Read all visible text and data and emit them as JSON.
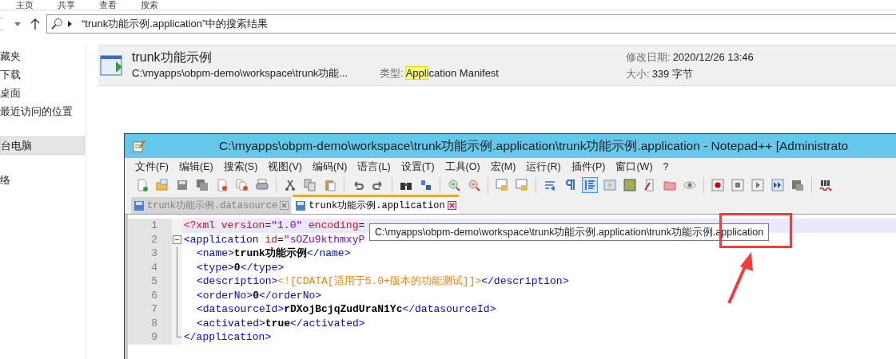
{
  "ribbon_tabs": [
    {
      "label": "主页"
    },
    {
      "label": "共享"
    },
    {
      "label": "查看"
    },
    {
      "label": "搜索"
    }
  ],
  "address_bar": {
    "text": "“trunk功能示例.application”中的搜索结果"
  },
  "sidebar": {
    "groups": [
      {
        "items": [
          {
            "label": "藏夹",
            "selected": false
          },
          {
            "label": "下载",
            "selected": false
          },
          {
            "label": "桌面",
            "selected": false
          },
          {
            "label": "最近访问的位置",
            "selected": false
          }
        ]
      },
      {
        "items": [
          {
            "label": "台电脑",
            "selected": true
          }
        ]
      },
      {
        "items": [
          {
            "label": "络",
            "selected": false
          }
        ]
      }
    ]
  },
  "result": {
    "name": "trunk功能示例",
    "path": "C:\\myapps\\obpm-demo\\workspace\\trunk功能...",
    "type_label": "类型:",
    "type_match": "Appl",
    "type_rest": "ication Manifest",
    "date_label": "修改日期:",
    "date_value": "2020/12/26 13:46",
    "size_label": "大小:",
    "size_value": "339 字节"
  },
  "notepad": {
    "title": "C:\\myapps\\obpm-demo\\workspace\\trunk功能示例.application\\trunk功能示例.application - Notepad++ [Administrato",
    "menu": [
      "文件(F)",
      "编辑(E)",
      "搜索(S)",
      "视图(V)",
      "编码(N)",
      "语言(L)",
      "设置(T)",
      "工具(O)",
      "宏(M)",
      "运行(R)",
      "插件(P)",
      "窗口(W)",
      "?"
    ],
    "toolbar": [
      {
        "kind": "new",
        "selected": false
      },
      {
        "kind": "open",
        "selected": false
      },
      {
        "kind": "save",
        "selected": false
      },
      {
        "kind": "saveall",
        "selected": false
      },
      {
        "kind": "close",
        "selected": false
      },
      {
        "kind": "closeall",
        "selected": false
      },
      {
        "kind": "print",
        "selected": false
      },
      {
        "kind": "sep"
      },
      {
        "kind": "cut",
        "selected": false
      },
      {
        "kind": "copy",
        "selected": false
      },
      {
        "kind": "paste",
        "selected": false
      },
      {
        "kind": "sep"
      },
      {
        "kind": "undo",
        "selected": false
      },
      {
        "kind": "redo",
        "selected": false
      },
      {
        "kind": "sep"
      },
      {
        "kind": "find",
        "selected": false
      },
      {
        "kind": "replace",
        "selected": false
      },
      {
        "kind": "sep"
      },
      {
        "kind": "zoomin",
        "selected": false
      },
      {
        "kind": "zoomout",
        "selected": false
      },
      {
        "kind": "sep"
      },
      {
        "kind": "syncv",
        "selected": false
      },
      {
        "kind": "synch",
        "selected": false
      },
      {
        "kind": "sep"
      },
      {
        "kind": "wrap",
        "selected": false
      },
      {
        "kind": "para",
        "selected": false
      },
      {
        "kind": "indent",
        "selected": true
      },
      {
        "kind": "lang",
        "selected": false
      },
      {
        "kind": "map",
        "selected": false
      },
      {
        "kind": "func",
        "selected": false
      },
      {
        "kind": "folder",
        "selected": false
      },
      {
        "kind": "eye",
        "selected": false
      },
      {
        "kind": "sep"
      },
      {
        "kind": "record",
        "selected": false
      },
      {
        "kind": "stop",
        "selected": false
      },
      {
        "kind": "play",
        "selected": false
      },
      {
        "kind": "playmulti",
        "selected": false
      },
      {
        "kind": "savemacro",
        "selected": false
      },
      {
        "kind": "sep"
      },
      {
        "kind": "spell",
        "selected": false
      }
    ],
    "tabs": [
      {
        "label": "trunk功能示例.datasource",
        "selected": false
      },
      {
        "label": "trunk功能示例.application",
        "selected": true
      }
    ],
    "lines": [
      {
        "number": "1",
        "kind": "plain",
        "current": true,
        "segments": [
          {
            "kind": "pi",
            "text": "<?xml"
          },
          {
            "kind": "attr",
            "text": " version"
          },
          {
            "kind": "eq",
            "text": "="
          },
          {
            "kind": "value",
            "text": "\"1.0\""
          },
          {
            "kind": "attr",
            "text": " encoding"
          },
          {
            "kind": "eq",
            "text": "="
          }
        ]
      },
      {
        "number": "2",
        "kind": "fold-start",
        "current": false,
        "segments": [
          {
            "kind": "tag",
            "text": "<application"
          },
          {
            "kind": "attr",
            "text": " id"
          },
          {
            "kind": "eq",
            "text": "="
          },
          {
            "kind": "value",
            "text": "\"sOZu9kthmxyP"
          }
        ]
      },
      {
        "number": "3",
        "kind": "fold-body",
        "current": false,
        "segments": [
          {
            "kind": "tag",
            "text": "<name>"
          },
          {
            "kind": "text",
            "text": "trunk功能示例"
          },
          {
            "kind": "tag",
            "text": "</name>"
          }
        ]
      },
      {
        "number": "4",
        "kind": "fold-body",
        "current": false,
        "segments": [
          {
            "kind": "tag",
            "text": "<type>"
          },
          {
            "kind": "text",
            "text": "0"
          },
          {
            "kind": "tag",
            "text": "</type>"
          }
        ]
      },
      {
        "number": "5",
        "kind": "fold-body",
        "current": false,
        "segments": [
          {
            "kind": "tag",
            "text": "<description>"
          },
          {
            "kind": "cdata",
            "text": "<![CDATA[适用于5.0+版本的功能测试]]>"
          },
          {
            "kind": "tag",
            "text": "</description>"
          }
        ]
      },
      {
        "number": "6",
        "kind": "fold-body",
        "current": false,
        "segments": [
          {
            "kind": "tag",
            "text": "<orderNo>"
          },
          {
            "kind": "text",
            "text": "0"
          },
          {
            "kind": "tag",
            "text": "</orderNo>"
          }
        ]
      },
      {
        "number": "7",
        "kind": "fold-body",
        "current": false,
        "segments": [
          {
            "kind": "tag",
            "text": "<datasourceId>"
          },
          {
            "kind": "text",
            "text": "rDXojBcjqZudUraN1Yc"
          },
          {
            "kind": "tag",
            "text": "</datasourceId>"
          }
        ]
      },
      {
        "number": "8",
        "kind": "fold-body",
        "current": false,
        "segments": [
          {
            "kind": "tag",
            "text": "<activated>"
          },
          {
            "kind": "text",
            "text": "true"
          },
          {
            "kind": "tag",
            "text": "</activated>"
          }
        ]
      },
      {
        "number": "9",
        "kind": "fold-end",
        "current": false,
        "segments": [
          {
            "kind": "tag",
            "text": "</application>"
          }
        ]
      }
    ],
    "tooltip": "C:\\myapps\\obpm-demo\\workspace\\trunk功能示例.application\\trunk功能示例.application"
  }
}
